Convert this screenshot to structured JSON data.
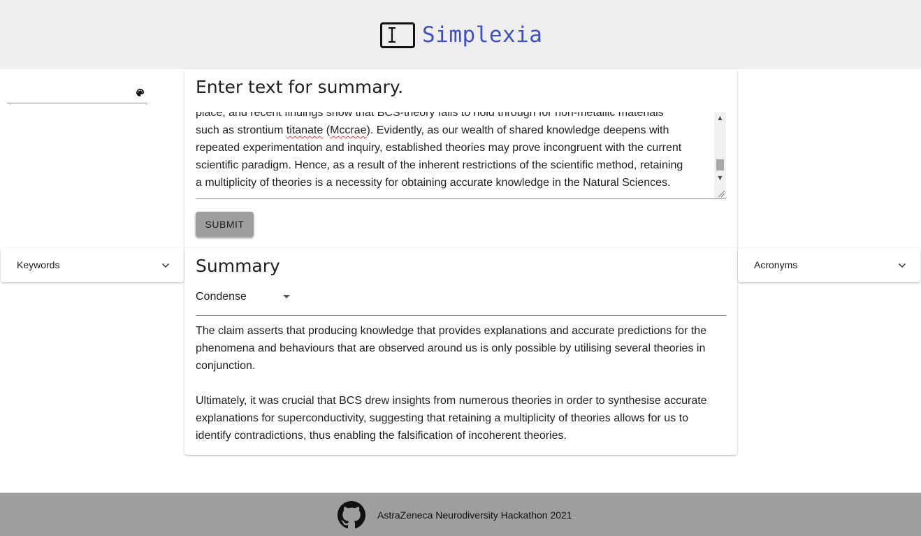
{
  "header": {
    "app_name": "Simplexia",
    "brand_color": "#3f51b5",
    "logo_icon": "text-cursor-screen-icon"
  },
  "font_selector": {
    "value": "",
    "icon": "palette-icon"
  },
  "input_card": {
    "title": "Enter text for summary.",
    "textarea_lines": [
      "place, and recent findings show that BCS-theory fails to hold through for non-metallic materials",
      "such as strontium ",
      "titanate",
      " (",
      "Mccrae",
      "). Evidently, as our wealth of shared knowledge deepens with",
      "repeated experimentation and inquiry, established theories may prove incongruent with the current",
      "scientific paradigm. Hence, as a result of the inherent restrictions of the scientific method, retaining",
      "a multiplicity of theories is a necessity for obtaining accurate knowledge in the Natural Sciences."
    ],
    "submit_label": "Submit"
  },
  "summary_card": {
    "title": "Summary",
    "mode_selected": "Condense",
    "paragraphs": [
      "The claim asserts that producing knowledge that provides explanations and accurate predictions for the phenomena and behaviours that are observed around us is only possible by utilising several theories in conjunction.",
      "Ultimately, it was crucial that BCS drew insights from numerous theories in order to synthesise accurate explanations for superconductivity, suggesting that retaining a multiplicity of theories allows for us to identify contradictions, thus enabling the falsification of incoherent theories."
    ]
  },
  "panels": {
    "left_label": "Keywords",
    "right_label": "Acronyms"
  },
  "footer": {
    "text": "AstraZeneca Neurodiversity Hackathon 2021",
    "icon": "github-icon"
  }
}
